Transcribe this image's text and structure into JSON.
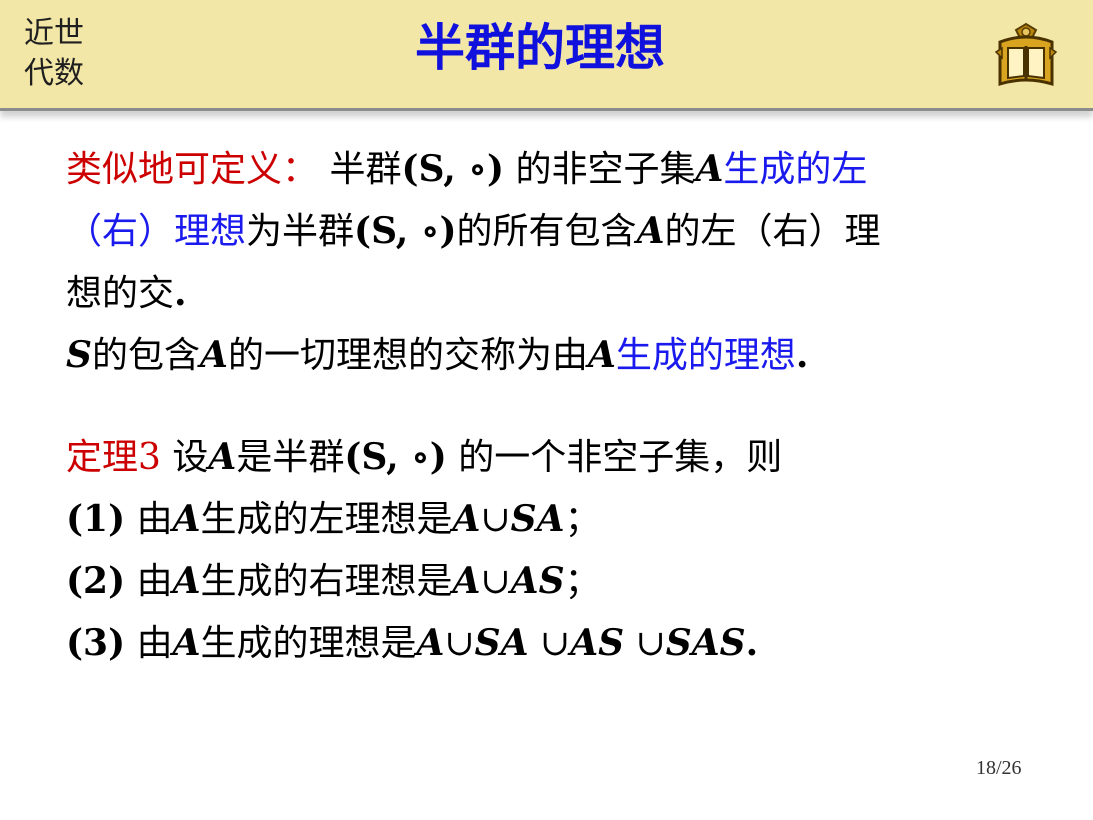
{
  "header": {
    "course_line1": "近世",
    "course_line2": "代数",
    "title": "半群的理想",
    "logo_icon": "book-shield-logo-icon"
  },
  "body": {
    "l1_def": "类似地可定义：",
    "l1_a": "半群",
    "l1_b": "(S, ∘)",
    "l1_c": " 的非空子集",
    "l1_d": "A",
    "l1_e": "生成的左",
    "l2_a": "（右）理想",
    "l2_b": "为半群",
    "l2_c": "(S, ∘)",
    "l2_d": "的所有包含",
    "l2_e": "A",
    "l2_f": "的左（右）理",
    "l3_a": "想的交",
    "l3_b": ".",
    "l4_a": "S",
    "l4_b": "的包含",
    "l4_c": "A",
    "l4_d": "的一切理想的交称为由",
    "l4_e": "A",
    "l4_f": "生成的理想",
    "l4_g": ".",
    "t_label": "定理3",
    "t_a": "设",
    "t_b": "A",
    "t_c": "是半群",
    "t_d": "(S, ∘)",
    "t_e": " 的一个非空子集，则",
    "i1_num": "(1)",
    "i1_a": " 由",
    "i1_b": "A",
    "i1_c": "生成的左理想是",
    "i1_d": "A",
    "i1_e": "∪",
    "i1_f": "SA",
    "i1_g": "；",
    "i2_num": "(2)",
    "i2_a": " 由",
    "i2_b": "A",
    "i2_c": "生成的右理想是",
    "i2_d": "A",
    "i2_e": "∪",
    "i2_f": "AS",
    "i2_g": "；",
    "i3_num": "(3)",
    "i3_a": " 由",
    "i3_b": "A",
    "i3_c": "生成的理想是",
    "i3_d": "A",
    "i3_e": "∪",
    "i3_f": "SA",
    "i3_g": " ∪",
    "i3_h": "AS",
    "i3_i": " ∪",
    "i3_j": "SAS",
    "i3_k": "."
  },
  "footer": {
    "page_number": "18/26"
  },
  "colors": {
    "header_bg": "#f3e7a7",
    "title": "#1111dd",
    "definition_label": "#cc0000",
    "highlight_blue": "#1a1aee",
    "body_text": "#000000"
  }
}
